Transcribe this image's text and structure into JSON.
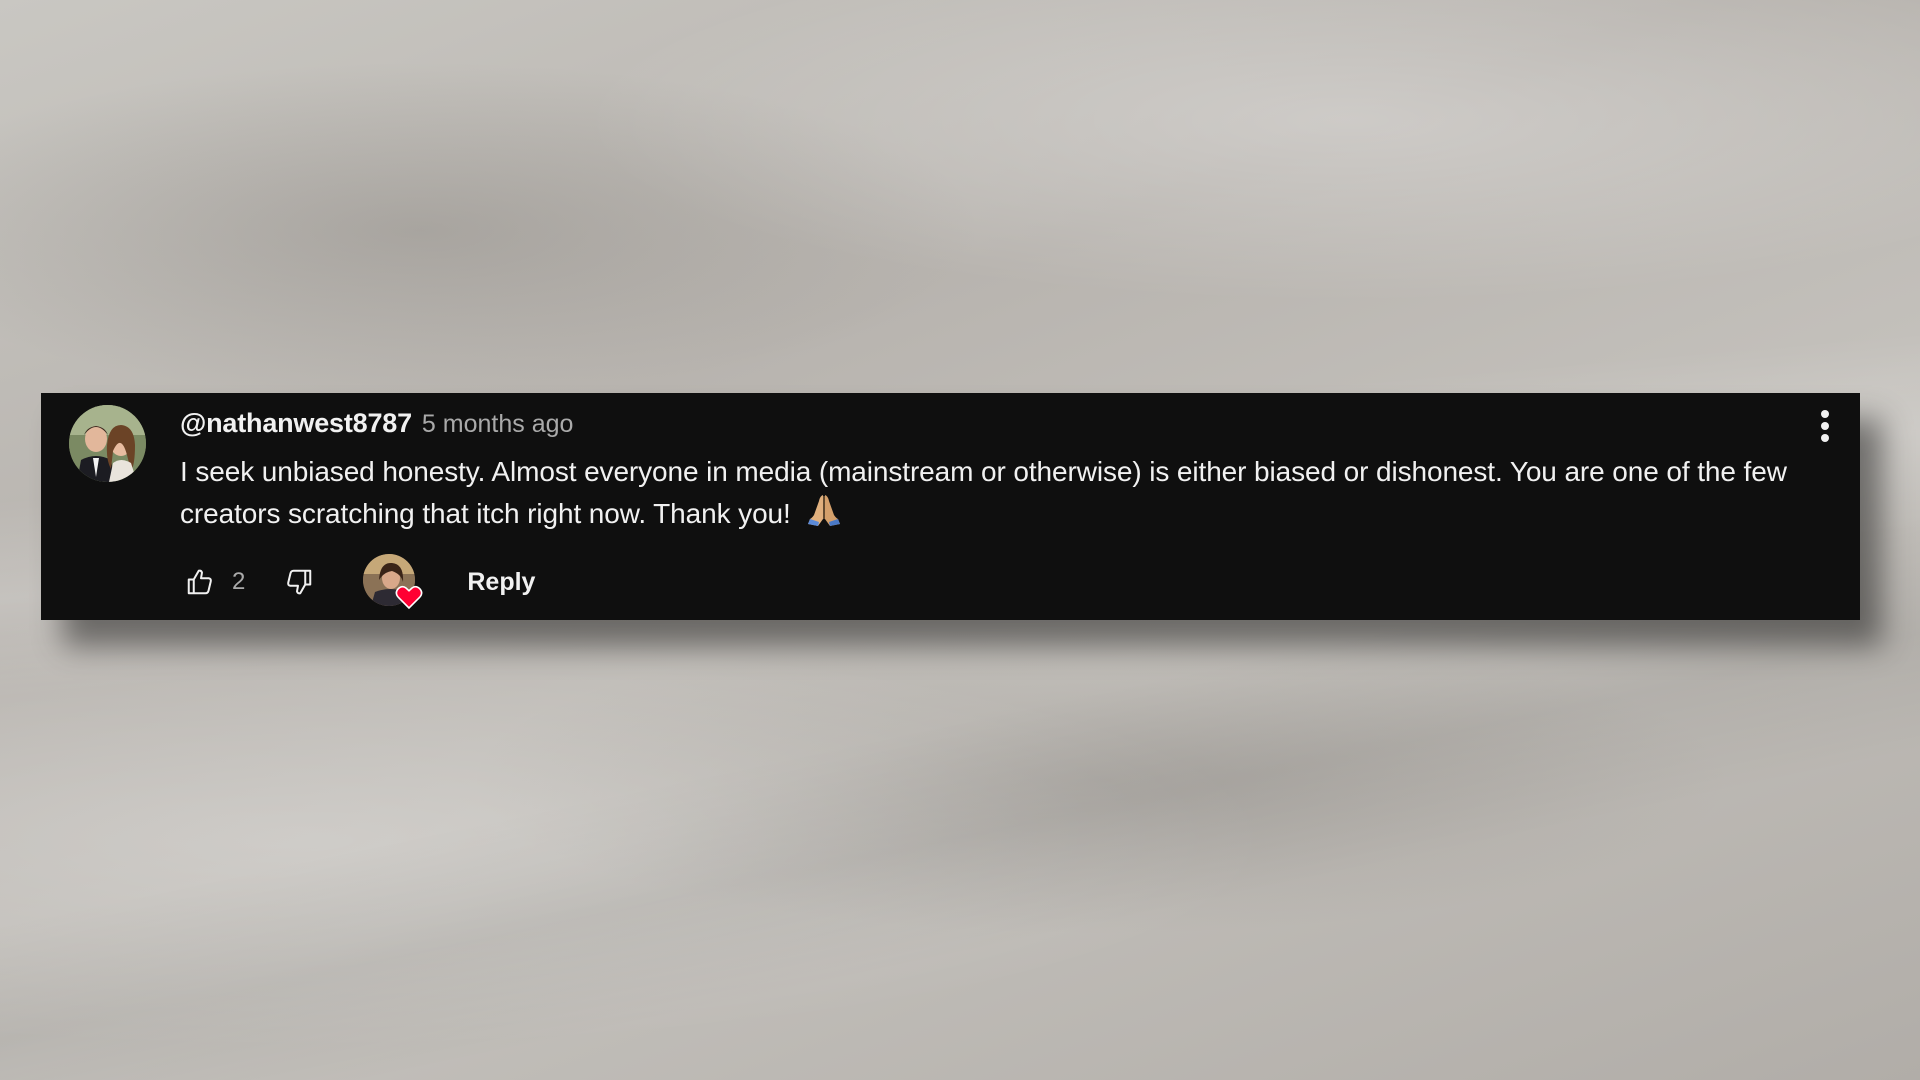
{
  "comment": {
    "author": "@nathanwest8787",
    "timestamp": "5 months ago",
    "text": "I seek unbiased honesty. Almost everyone in media (mainstream or otherwise) is either biased or dishonest. You are one of the few creators scratching that itch right now. Thank you!",
    "emoji": "folded-hands-emoji",
    "like_count": "2",
    "reply_label": "Reply",
    "creator_heart": true
  },
  "icons": {
    "like": "thumbs-up-icon",
    "dislike": "thumbs-down-icon",
    "more": "three-dot-menu-icon",
    "heart": "heart-icon"
  },
  "colors": {
    "card_background": "#0f0f0f",
    "primary_text": "#f1f1f1",
    "secondary_text": "#aaaaaa",
    "heart": "#ff0033"
  }
}
